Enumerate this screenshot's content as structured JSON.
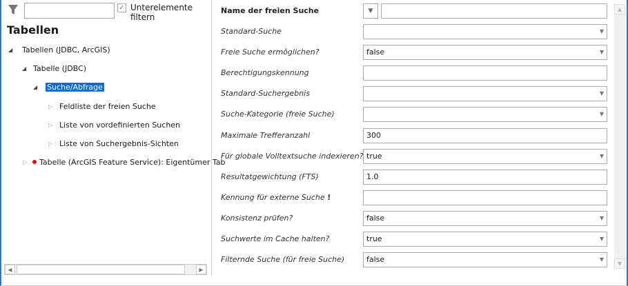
{
  "filter": {
    "placeholder": "",
    "value": "",
    "checkbox_label": "Unterelemente filtern",
    "checked": true
  },
  "tree": {
    "title": "Tabellen",
    "nodes": [
      {
        "label": "Tabellen (JDBC, ArcGIS)",
        "expanded": true
      },
      {
        "label": "Tabelle (JDBC)",
        "expanded": true
      },
      {
        "label": "Suche/Abfrage",
        "expanded": true,
        "selected": true
      },
      {
        "label": "Feldliste der freien Suche",
        "expanded": false
      },
      {
        "label": "Liste von vordefinierten Suchen",
        "expanded": false
      },
      {
        "label": "Liste von Suchergebnis-Sichten",
        "expanded": false
      },
      {
        "label": "Tabelle (ArcGIS Feature Service): Eigentümer Tab",
        "expanded": false,
        "error": true
      }
    ]
  },
  "properties": [
    {
      "label": "Name der freien Suche",
      "value": "",
      "type": "combo-text"
    },
    {
      "label": "Standard-Suche",
      "value": "",
      "type": "select"
    },
    {
      "label": "Freie Suche ermöglichen?",
      "value": "false",
      "type": "select"
    },
    {
      "label": "Berechtigungskennung",
      "value": "",
      "type": "text"
    },
    {
      "label": "Standard-Suchergebnis",
      "value": "",
      "type": "select"
    },
    {
      "label": "Suche-Kategorie (freie Suche)",
      "value": "",
      "type": "select"
    },
    {
      "label": "Maximale Trefferanzahl",
      "value": "300",
      "type": "text"
    },
    {
      "label": "Für globale Volltextsuche indexieren?",
      "value": "true",
      "type": "select"
    },
    {
      "label": "Resultatgewichtung (FTS)",
      "value": "1.0",
      "type": "text"
    },
    {
      "label": "Kennung für externe Suche",
      "value": "",
      "type": "text",
      "required_mark": "!"
    },
    {
      "label": "Konsistenz prüfen?",
      "value": "false",
      "type": "select"
    },
    {
      "label": "Suchwerte im Cache halten?",
      "value": "true",
      "type": "select"
    },
    {
      "label": "Filternde Suche (für freie Suche)",
      "value": "false",
      "type": "select"
    }
  ]
}
